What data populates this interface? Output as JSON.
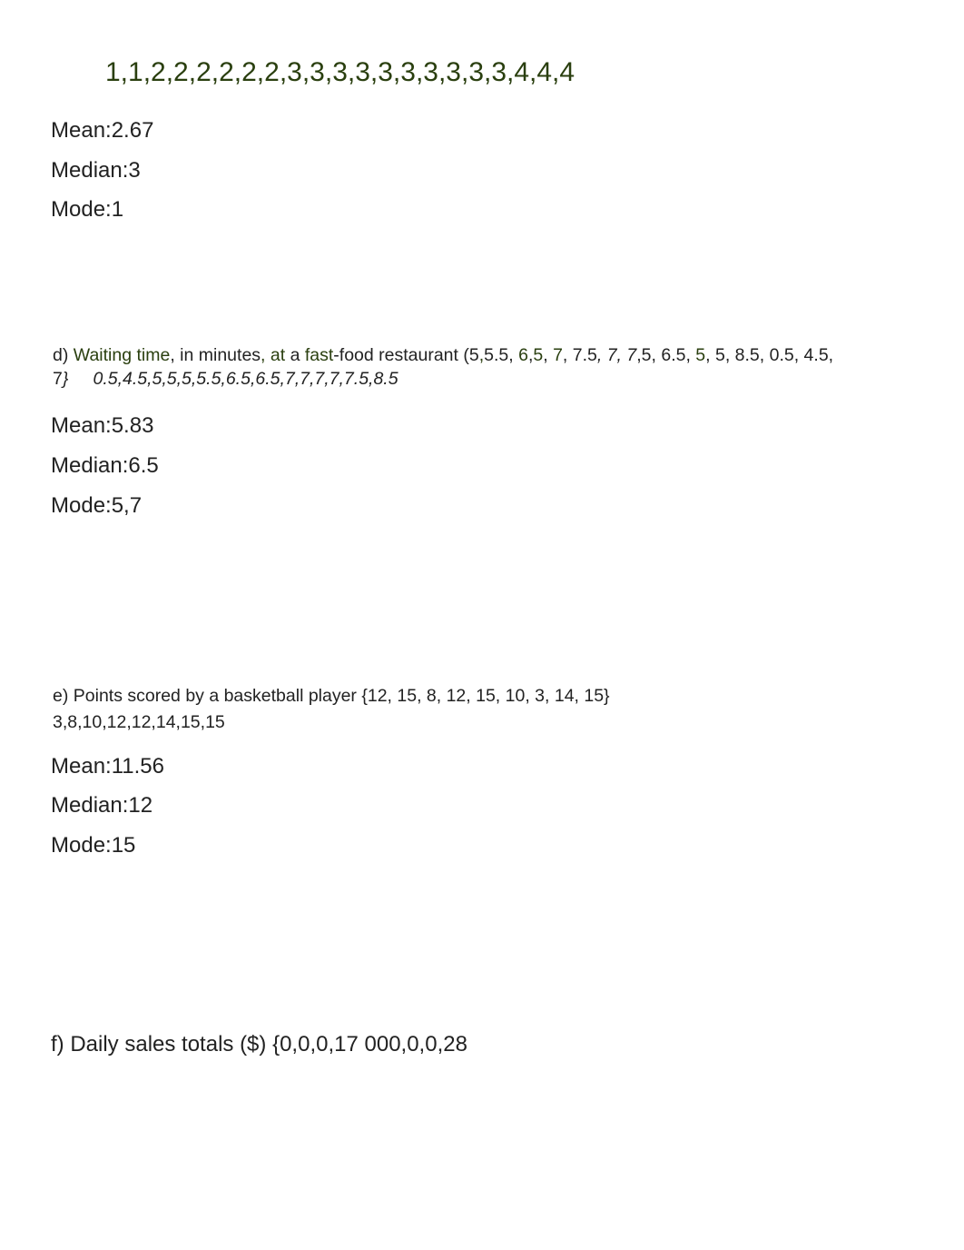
{
  "c": {
    "sorted": "1,1,2,2,2,2,2,2,3,3,3,3,3,3,3,3,3,3,4,4,4",
    "mean": "Mean:2.67",
    "median": "Median:3",
    "mode": "Mode:1"
  },
  "d": {
    "prompt_prefix": "d) ",
    "green1": "Waiting time",
    "black1": ", in minutes",
    "green2": ", at",
    "black2": " a ",
    "green3": "fast",
    "black3": "-food restaurant (5",
    "green4": ",",
    "black4": "5.5, ",
    "green5": "6",
    "black5": ",",
    "green6": "5",
    "black6": ", ",
    "green7": "7",
    "black7": ", 7.5",
    "ital_part": ", 7, 7",
    "black8": ",5, 6.5, ",
    "green8": "5",
    "black9": ", 5, 8.5, 0.5, 4.5, 7",
    "closing_curly": "}",
    "sorted_ital": "0.5,4.5,5,5,5,5.5,6.5,6.5,7,7,7,7,7.5,8.5",
    "mean": "Mean:5.83",
    "median": "Median:6.5",
    "mode": "Mode:5,7"
  },
  "e": {
    "prompt": "e) Points scored by a basketball player {12, 15, 8, 12, 15, 10, 3, 14, 15}",
    "sorted": "3,8,10,12,12,14,15,15",
    "mean": "Mean:11.56",
    "median": "Median:12",
    "mode": "Mode:15"
  },
  "f": {
    "prompt": "f) Daily sales totals ($) {0,0,0,17 000,0,0,28"
  }
}
